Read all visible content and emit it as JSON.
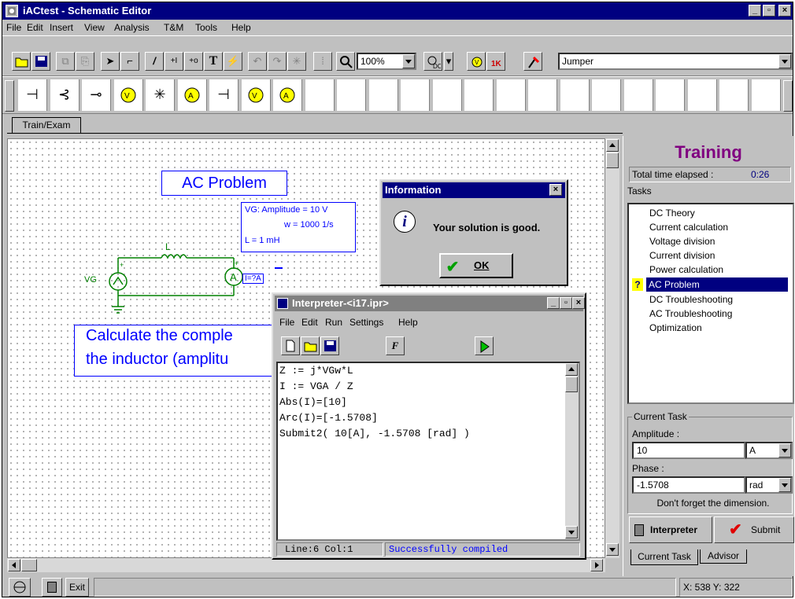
{
  "window": {
    "title": "iACtest - Schematic Editor"
  },
  "menu": [
    "File",
    "Edit",
    "Insert",
    "View",
    "Analysis",
    "T&M",
    "Tools",
    "Help"
  ],
  "toolbar": {
    "zoom_value": "100%",
    "component_value": "Jumper"
  },
  "tabs": {
    "train_exam": "Train/Exam"
  },
  "schematic": {
    "title_box": "AC Problem",
    "params": [
      "VG:  Amplitude = 10 V",
      "w = 1000 1/s",
      "L  = 1 mH"
    ],
    "inductor_label": "L",
    "source_label": "VG",
    "ammeter_label": "I=?A",
    "question_line1": "Calculate the comple",
    "question_line2": "the inductor (amplitu"
  },
  "info_dialog": {
    "title": "Information",
    "message": "Your solution is good.",
    "ok_label": "OK",
    "close": "×"
  },
  "interpreter": {
    "title": "Interpreter-<i17.ipr>",
    "menu": [
      "File",
      "Edit",
      "Run",
      "Settings",
      "Help"
    ],
    "code": [
      "Z := j*VGw*L",
      "I := VGA / Z",
      "Abs(I)=[10]",
      "Arc(I)=[-1.5708]",
      "Submit2( 10[A], -1.5708 [rad] )"
    ],
    "status_position": "Line:6 Col:1",
    "status_message": "Successfully compiled"
  },
  "training": {
    "title": "Training",
    "time_label": "Total time elapsed :",
    "time_value": "0:26",
    "tasks_label": "Tasks",
    "tasks": [
      "DC Theory",
      "Current calculation",
      "Voltage division",
      "Current division",
      "Power calculation",
      "AC Problem",
      "DC Troubleshooting",
      "AC Troubleshooting",
      "Optimization"
    ],
    "active_marker": "?",
    "current_task_label": "Current Task",
    "amplitude_label": "Amplitude :",
    "amplitude_value": "10",
    "amplitude_unit": "A",
    "phase_label": "Phase :",
    "phase_value": "-1.5708",
    "phase_unit": "rad",
    "hint": "Don't forget the dimension.",
    "interpreter_button": "Interpreter",
    "submit_button": "Submit",
    "tab_current": "Current Task",
    "tab_advisor": "Advisor"
  },
  "statusbar": {
    "exit_label": "Exit",
    "coords": "X: 538 Y: 322"
  },
  "colors": {
    "titlebar": "#000080",
    "schematic_blue": "#0000ff",
    "circuit_green": "#008000",
    "training_title": "#800080"
  }
}
